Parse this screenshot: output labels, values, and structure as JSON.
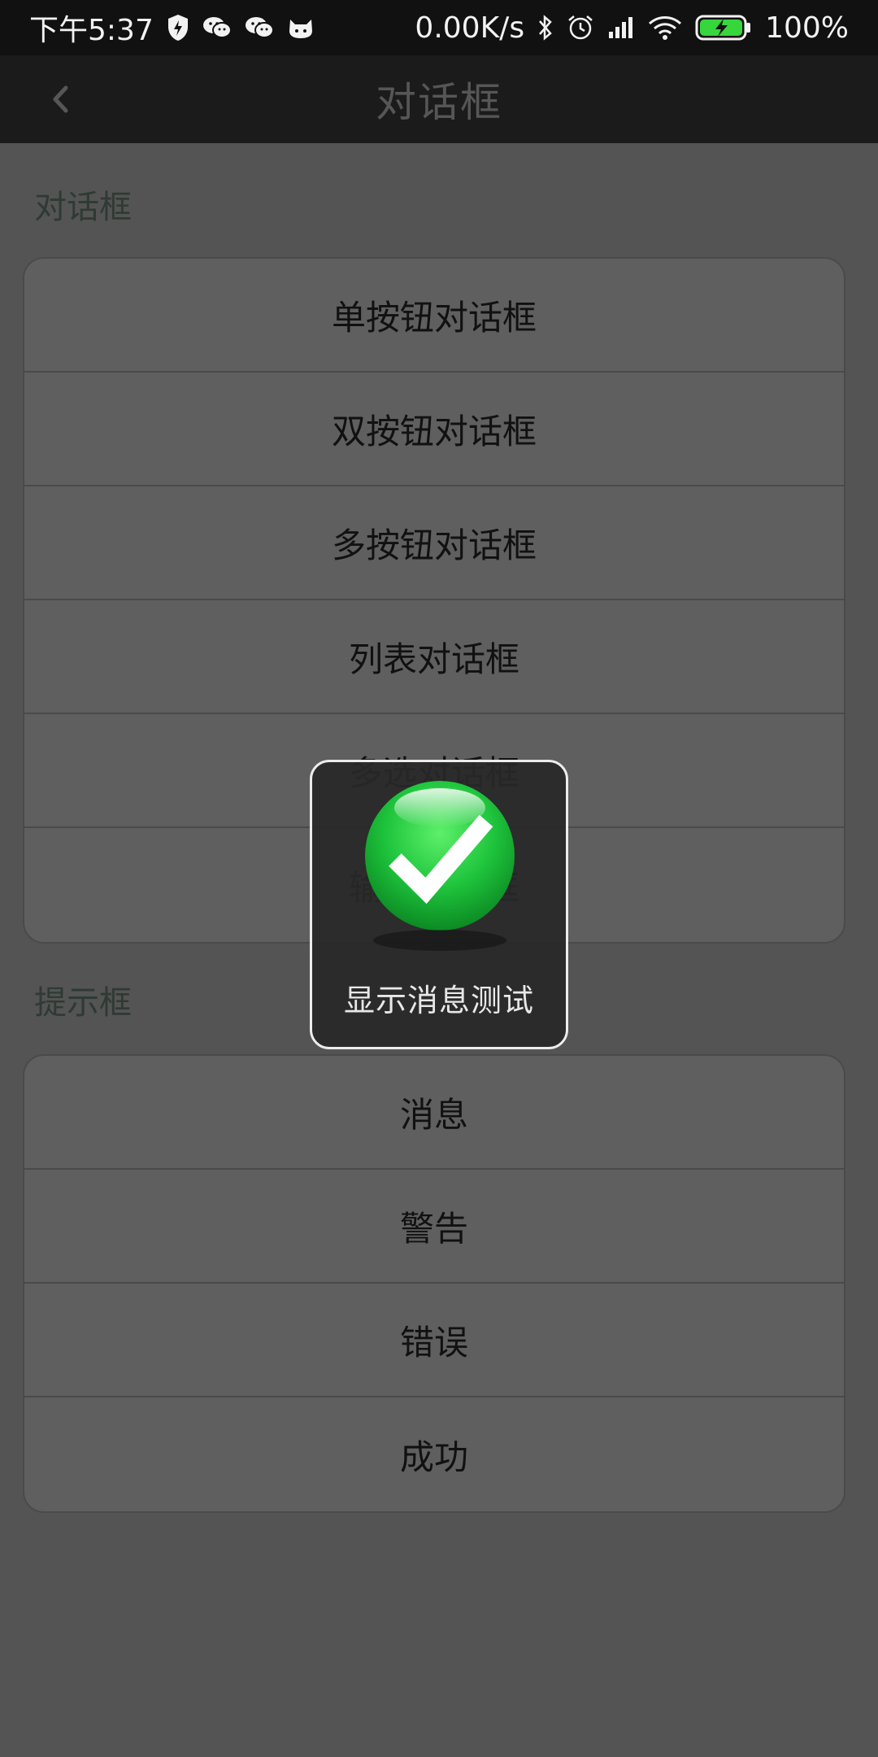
{
  "status_bar": {
    "time": "下午5:37",
    "network_speed": "0.00K/s",
    "battery": "100%",
    "icons": [
      "shield-icon",
      "wechat-icon",
      "wechat-icon",
      "cat-icon",
      "bluetooth-icon",
      "alarm-icon",
      "signal-icon",
      "wifi-icon",
      "battery-charging-icon"
    ]
  },
  "nav": {
    "title": "对话框",
    "back_icon": "chevron-left-icon"
  },
  "sections": {
    "dialogs": {
      "title": "对话框",
      "items": [
        "单按钮对话框",
        "双按钮对话框",
        "多按钮对话框",
        "列表对话框",
        "多选对话框",
        "输入对话框"
      ]
    },
    "tips": {
      "title": "提示框",
      "items": [
        "消息",
        "警告",
        "错误",
        "成功"
      ]
    }
  },
  "toast": {
    "message": "显示消息测试",
    "icon": "checkmark-success-icon"
  },
  "colors": {
    "success_green": "#1fc53d",
    "overlay_bg": "#545454",
    "toast_bg": "#2a2a2a"
  }
}
